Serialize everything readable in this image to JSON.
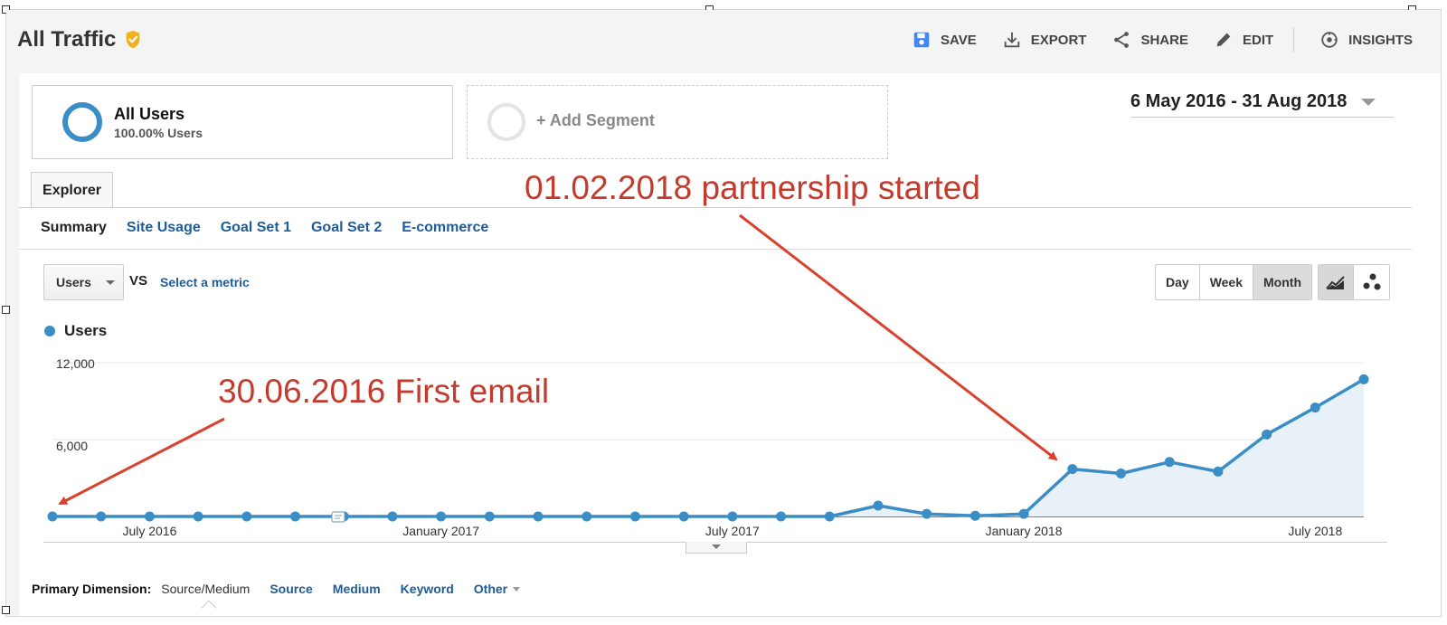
{
  "header": {
    "title": "All Traffic",
    "actions": [
      {
        "label": "SAVE",
        "icon": "save-icon"
      },
      {
        "label": "EXPORT",
        "icon": "export-icon"
      },
      {
        "label": "SHARE",
        "icon": "share-icon"
      },
      {
        "label": "EDIT",
        "icon": "edit-icon"
      },
      {
        "label": "INSIGHTS",
        "icon": "insights-icon"
      }
    ]
  },
  "segments": {
    "primary": {
      "name": "All Users",
      "sub": "100.00% Users"
    },
    "add_label": "+ Add Segment"
  },
  "date_range": "6 May 2016 - 31 Aug 2018",
  "tabs": {
    "explorer": "Explorer"
  },
  "subtabs": [
    "Summary",
    "Site Usage",
    "Goal Set 1",
    "Goal Set 2",
    "E-commerce"
  ],
  "controls": {
    "metric": "Users",
    "vs": "VS",
    "select_metric": "Select a metric",
    "periods": [
      "Day",
      "Week",
      "Month"
    ],
    "active_period": "Month"
  },
  "legend": {
    "label": "Users"
  },
  "annotations": {
    "first_email": "30.06.2016 First email",
    "partnership": "01.02.2018 partnership started"
  },
  "primary_dimension": {
    "label": "Primary Dimension:",
    "current": "Source/Medium",
    "options": [
      "Source",
      "Medium",
      "Keyword"
    ],
    "other": "Other"
  },
  "colors": {
    "series": "#3a8dc5",
    "area": "#e8f0f8",
    "annotation": "#c33b2c"
  },
  "chart_data": {
    "type": "area",
    "ylim": [
      0,
      12000
    ],
    "yticks": [
      "12,000",
      "6,000"
    ],
    "xticks": [
      "July 2016",
      "January 2017",
      "July 2017",
      "January 2018",
      "July 2018"
    ],
    "series": [
      {
        "name": "Users",
        "x": [
          "2016-05",
          "2016-06",
          "2016-07",
          "2016-08",
          "2016-09",
          "2016-10",
          "2016-11",
          "2016-12",
          "2017-01",
          "2017-02",
          "2017-03",
          "2017-04",
          "2017-05",
          "2017-06",
          "2017-07",
          "2017-08",
          "2017-09",
          "2017-10",
          "2017-11",
          "2017-12",
          "2018-01",
          "2018-02",
          "2018-03",
          "2018-04",
          "2018-05",
          "2018-06",
          "2018-07",
          "2018-08"
        ],
        "values": [
          0,
          0,
          0,
          0,
          0,
          0,
          0,
          0,
          0,
          0,
          0,
          0,
          0,
          0,
          0,
          0,
          0,
          850,
          200,
          50,
          200,
          3700,
          3350,
          4250,
          3500,
          6400,
          8500,
          10700
        ]
      }
    ]
  }
}
